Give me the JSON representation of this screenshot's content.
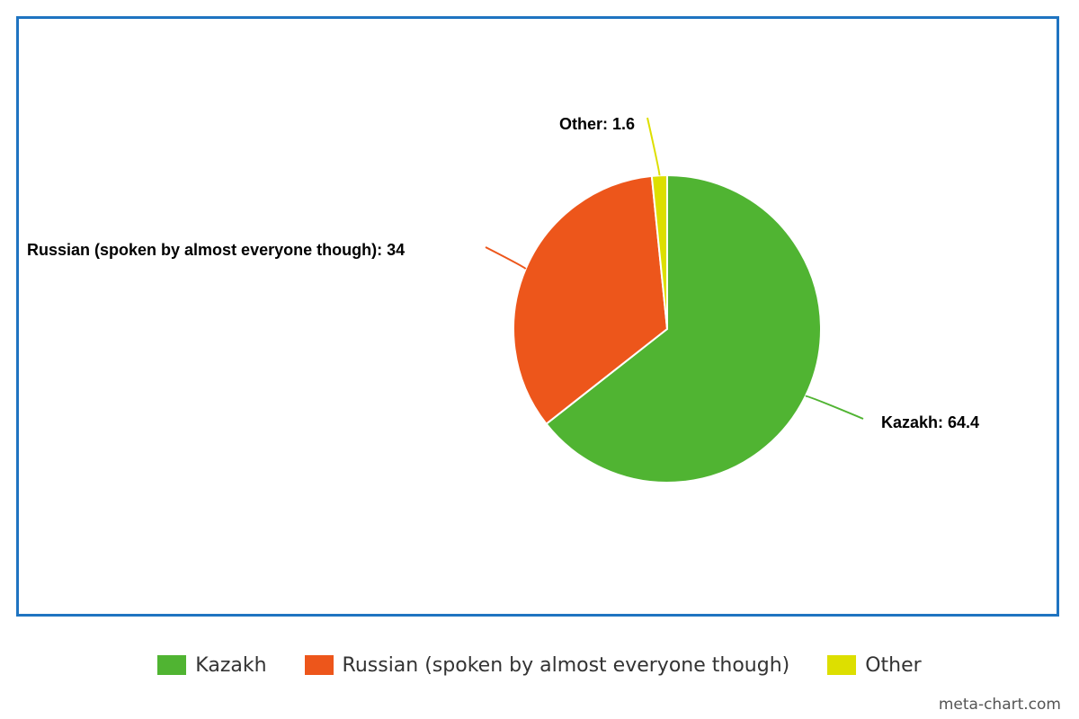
{
  "chart_data": {
    "type": "pie",
    "title": "",
    "slices": [
      {
        "name": "Kazakh",
        "value": 64.4,
        "label": "Kazakh: 64.4",
        "color": "#50b432"
      },
      {
        "name": "Russian (spoken by almost everyone though)",
        "value": 34,
        "label": "Russian (spoken by almost everyone though): 34",
        "color": "#ed561b"
      },
      {
        "name": "Other",
        "value": 1.6,
        "label": "Other: 1.6",
        "color": "#dddf00"
      }
    ],
    "legend": {
      "position": "bottom"
    }
  },
  "frame_color": "#1f74c1",
  "watermark": "meta-chart.com"
}
